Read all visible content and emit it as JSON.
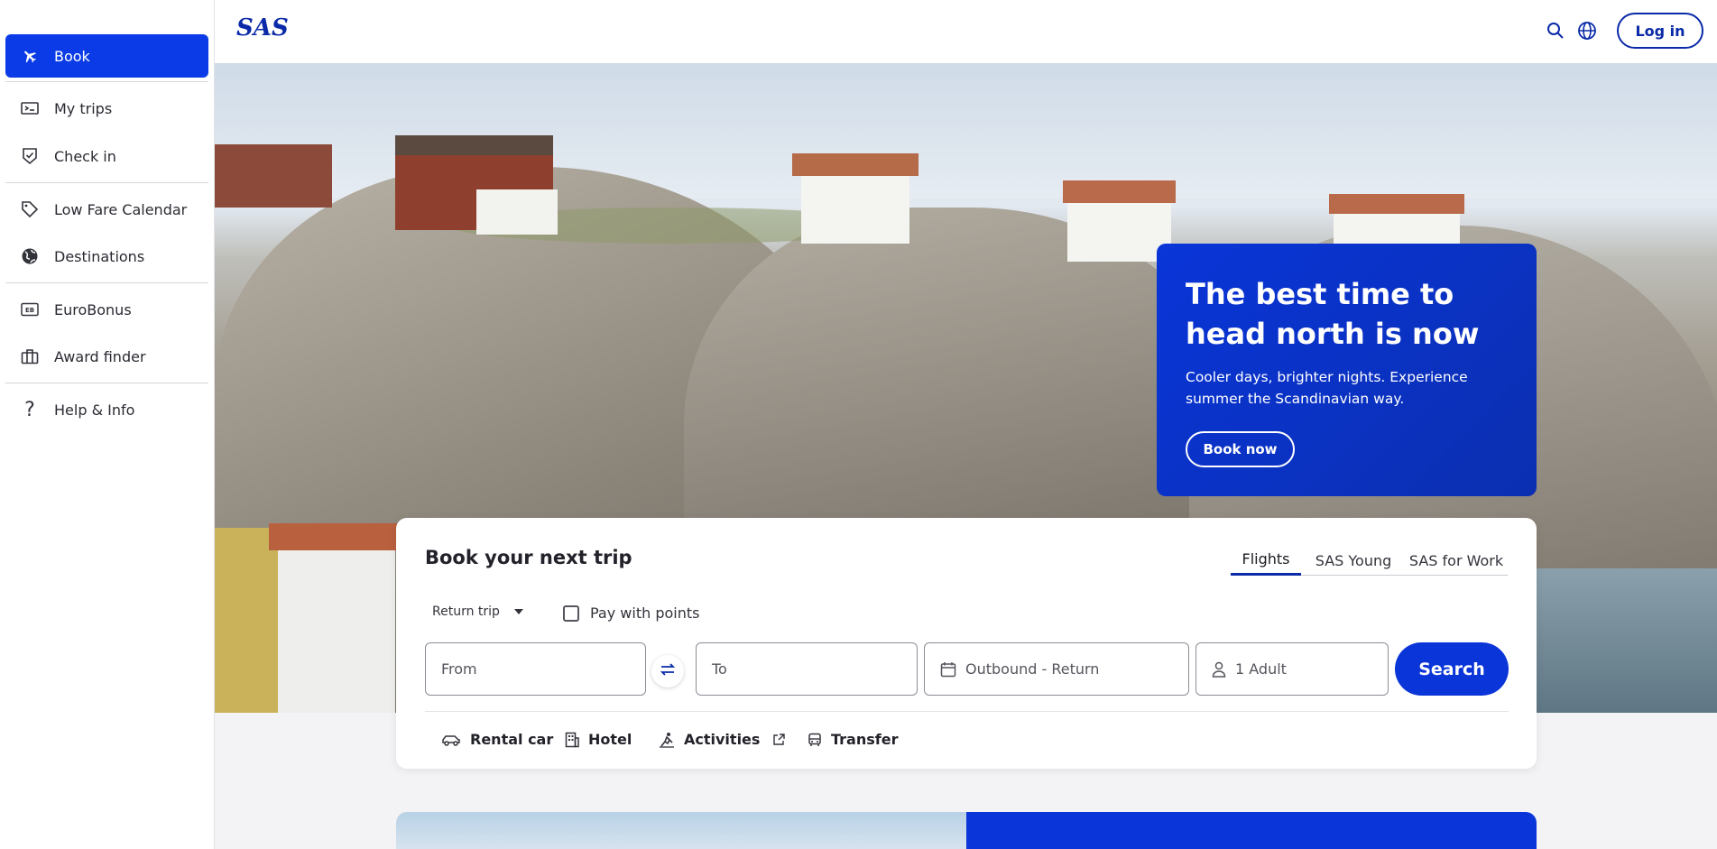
{
  "sidebar": {
    "items": [
      {
        "label": "Book",
        "icon": "plane-icon",
        "active": true
      },
      {
        "label": "My trips",
        "icon": "ticket-icon"
      },
      {
        "label": "Check in",
        "icon": "checkin-shield-icon"
      },
      {
        "label": "Low Fare Calendar",
        "icon": "tag-icon"
      },
      {
        "label": "Destinations",
        "icon": "globe-filled-icon"
      },
      {
        "label": "EuroBonus",
        "icon": "eurobonus-card-icon"
      },
      {
        "label": "Award finder",
        "icon": "briefcase-icon"
      },
      {
        "label": "Help & Info",
        "icon": "question-icon"
      }
    ]
  },
  "header": {
    "logo": "SAS",
    "login_label": "Log in",
    "search_icon": "search-icon",
    "language_icon": "globe-icon"
  },
  "promo": {
    "title": "The best time to head north is now",
    "text": "Cooler days, brighter nights. Experience summer the Scandinavian way.",
    "cta": "Book now"
  },
  "booking": {
    "title": "Book your next trip",
    "tabs": [
      {
        "label": "Flights",
        "active": true
      },
      {
        "label": "SAS Young"
      },
      {
        "label": "SAS for Work"
      }
    ],
    "trip_type": "Return trip",
    "pay_with_points": "Pay with points",
    "from_placeholder": "From",
    "to_placeholder": "To",
    "dates_placeholder": "Outbound - Return",
    "passengers": "1 Adult",
    "search_label": "Search",
    "extras": [
      {
        "label": "Rental car",
        "icon": "car-icon"
      },
      {
        "label": "Hotel",
        "icon": "hotel-icon"
      },
      {
        "label": "Activities",
        "icon": "activity-icon",
        "external": true
      },
      {
        "label": "Transfer",
        "icon": "bus-icon"
      }
    ]
  },
  "colors": {
    "brand_blue": "#0a35d8",
    "brand_dark": "#0a2aa8"
  }
}
